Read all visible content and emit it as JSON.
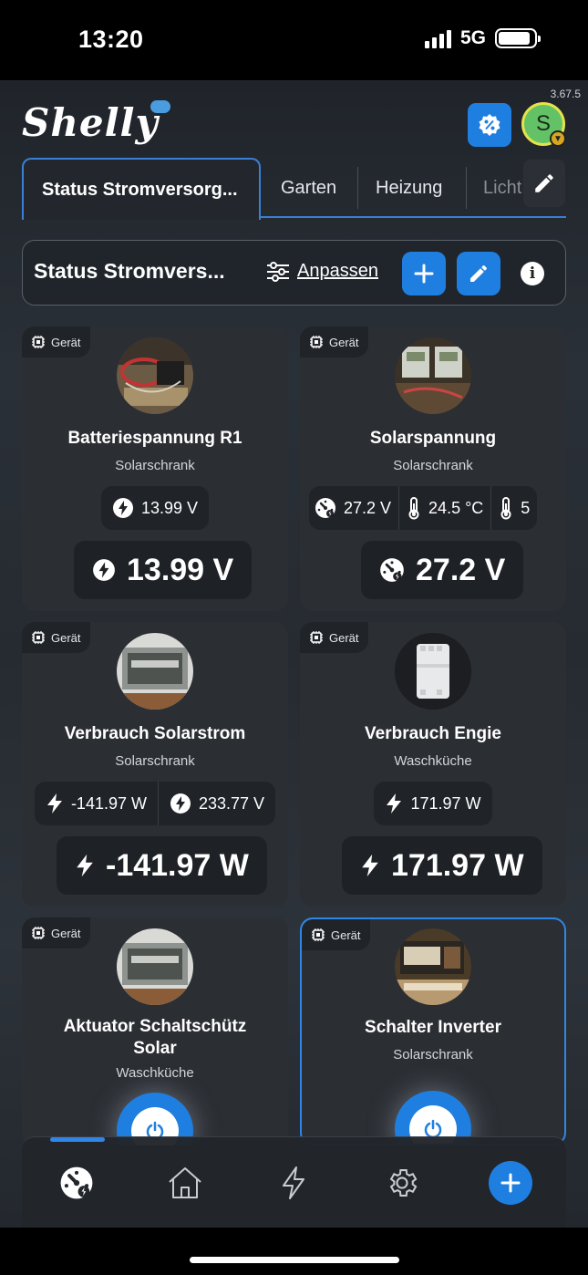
{
  "status_bar": {
    "time": "13:20",
    "network": "5G",
    "battery_percent": 95
  },
  "app": {
    "version": "3.67.5",
    "logo_text": "Shelly",
    "user_initial": "S"
  },
  "tabs": [
    {
      "label": "Status Stromversorg...",
      "active": true
    },
    {
      "label": "Garten",
      "active": false
    },
    {
      "label": "Heizung",
      "active": false
    },
    {
      "label": "Licht",
      "active": false
    }
  ],
  "dashboard": {
    "title": "Status Stromvers...",
    "customize_label": "Anpassen"
  },
  "cards": [
    {
      "badge": "Gerät",
      "title": "Batteriespannung R1",
      "room": "Solarschrank",
      "chips": [
        {
          "icon": "voltage-icon",
          "text": "13.99 V"
        }
      ],
      "big": {
        "icon": "voltage-icon",
        "text": "13.99 V"
      }
    },
    {
      "badge": "Gerät",
      "title": "Solarspannung",
      "room": "Solarschrank",
      "chips": [
        {
          "icon": "gauge-icon",
          "text": "27.2 V"
        },
        {
          "icon": "thermometer-icon",
          "text": "24.5 °C"
        },
        {
          "icon": "thermometer-icon",
          "text": "5"
        }
      ],
      "big": {
        "icon": "gauge-icon",
        "text": "27.2 V"
      }
    },
    {
      "badge": "Gerät",
      "title": "Verbrauch Solarstrom",
      "room": "Solarschrank",
      "chips": [
        {
          "icon": "power-icon",
          "text": "-141.97 W"
        },
        {
          "icon": "voltage-icon",
          "text": "233.77 V"
        }
      ],
      "big": {
        "icon": "power-icon",
        "text": "-141.97 W"
      }
    },
    {
      "badge": "Gerät",
      "title": "Verbrauch Engie",
      "room": "Waschküche",
      "chips": [
        {
          "icon": "power-icon",
          "text": "171.97 W"
        }
      ],
      "big": {
        "icon": "power-icon",
        "text": "171.97 W"
      }
    },
    {
      "badge": "Gerät",
      "title_line1": "Aktuator Schaltschütz",
      "title_line2": "Solar",
      "room": "Waschküche"
    },
    {
      "badge": "Gerät",
      "title": "Schalter Inverter",
      "room": "Solarschrank"
    }
  ],
  "colors": {
    "accent": "#1f7fe0",
    "card_bg": "#2b2e33",
    "chip_bg": "#202328",
    "selected_border": "#2f86e6"
  },
  "bottom_nav": [
    {
      "icon": "dashboard-icon",
      "active": true
    },
    {
      "icon": "home-icon",
      "active": false
    },
    {
      "icon": "energy-icon",
      "active": false
    },
    {
      "icon": "settings-icon",
      "active": false
    },
    {
      "icon": "add-icon",
      "active": false
    }
  ]
}
